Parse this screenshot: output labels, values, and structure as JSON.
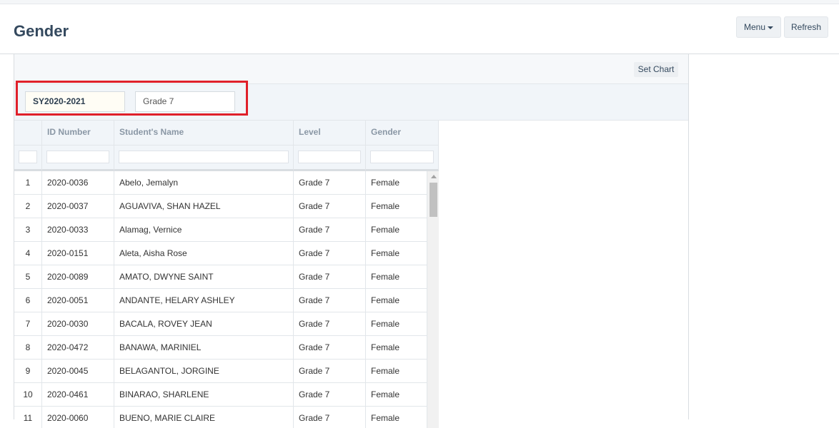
{
  "header": {
    "title": "Gender",
    "menu_label": "Menu",
    "refresh_label": "Refresh"
  },
  "toolbar": {
    "set_chart_label": "Set Chart"
  },
  "filters": {
    "school_year": "SY2020-2021",
    "grade": "Grade 7"
  },
  "table": {
    "columns": [
      "",
      "ID Number",
      "Student's Name",
      "Level",
      "Gender"
    ],
    "rows": [
      [
        "1",
        "2020-0036",
        "Abelo, Jemalyn",
        "Grade 7",
        "Female"
      ],
      [
        "2",
        "2020-0037",
        "AGUAVIVA, SHAN HAZEL",
        "Grade 7",
        "Female"
      ],
      [
        "3",
        "2020-0033",
        "Alamag, Vernice",
        "Grade 7",
        "Female"
      ],
      [
        "4",
        "2020-0151",
        "Aleta, Aisha Rose",
        "Grade 7",
        "Female"
      ],
      [
        "5",
        "2020-0089",
        "AMATO, DWYNE SAINT",
        "Grade 7",
        "Female"
      ],
      [
        "6",
        "2020-0051",
        "ANDANTE, HELARY ASHLEY",
        "Grade 7",
        "Female"
      ],
      [
        "7",
        "2020-0030",
        "BACALA, ROVEY JEAN",
        "Grade 7",
        "Female"
      ],
      [
        "8",
        "2020-0472",
        "BANAWA, MARINIEL",
        "Grade 7",
        "Female"
      ],
      [
        "9",
        "2020-0045",
        "BELAGANTOL, JORGINE",
        "Grade 7",
        "Female"
      ],
      [
        "10",
        "2020-0461",
        "BINARAO, SHARLENE",
        "Grade 7",
        "Female"
      ],
      [
        "11",
        "2020-0060",
        "BUENO, MARIE CLAIRE",
        "Grade 7",
        "Female"
      ]
    ]
  }
}
